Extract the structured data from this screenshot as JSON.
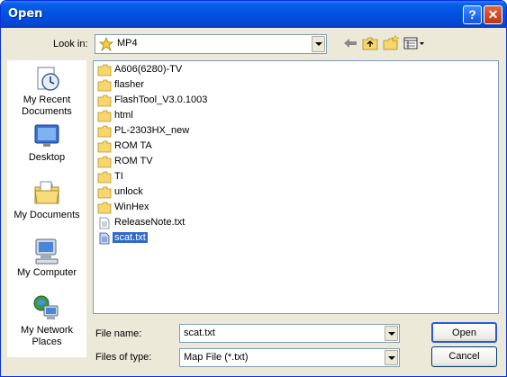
{
  "window": {
    "title": "Open",
    "help": "?",
    "close": "✕"
  },
  "lookin": {
    "label": "Look in:",
    "value": "MP4"
  },
  "places": [
    {
      "label": "My Recent Documents",
      "icon": "recent-documents-icon"
    },
    {
      "label": "Desktop",
      "icon": "desktop-icon"
    },
    {
      "label": "My Documents",
      "icon": "my-documents-icon"
    },
    {
      "label": "My Computer",
      "icon": "my-computer-icon"
    },
    {
      "label": "My Network Places",
      "icon": "network-places-icon"
    }
  ],
  "files": [
    {
      "name": "A606(6280)-TV",
      "type": "folder"
    },
    {
      "name": "flasher",
      "type": "folder"
    },
    {
      "name": "FlashTool_V3.0.1003",
      "type": "folder"
    },
    {
      "name": "html",
      "type": "folder"
    },
    {
      "name": "PL-2303HX_new",
      "type": "folder"
    },
    {
      "name": "ROM TA",
      "type": "folder"
    },
    {
      "name": "ROM TV",
      "type": "folder"
    },
    {
      "name": "TI",
      "type": "folder"
    },
    {
      "name": "unlock",
      "type": "folder"
    },
    {
      "name": "WinHex",
      "type": "folder"
    },
    {
      "name": "ReleaseNote.txt",
      "type": "text-file"
    },
    {
      "name": "scat.txt",
      "type": "text-file",
      "selected": true
    }
  ],
  "filename": {
    "label": "File name:",
    "value": "scat.txt"
  },
  "filetype": {
    "label": "Files of type:",
    "value": "Map File (*.txt)"
  },
  "buttons": {
    "open": "Open",
    "cancel": "Cancel"
  },
  "colors": {
    "titlebar": "#0055e5",
    "selection": "#316ac5",
    "dialog_bg": "#ece9d8"
  }
}
